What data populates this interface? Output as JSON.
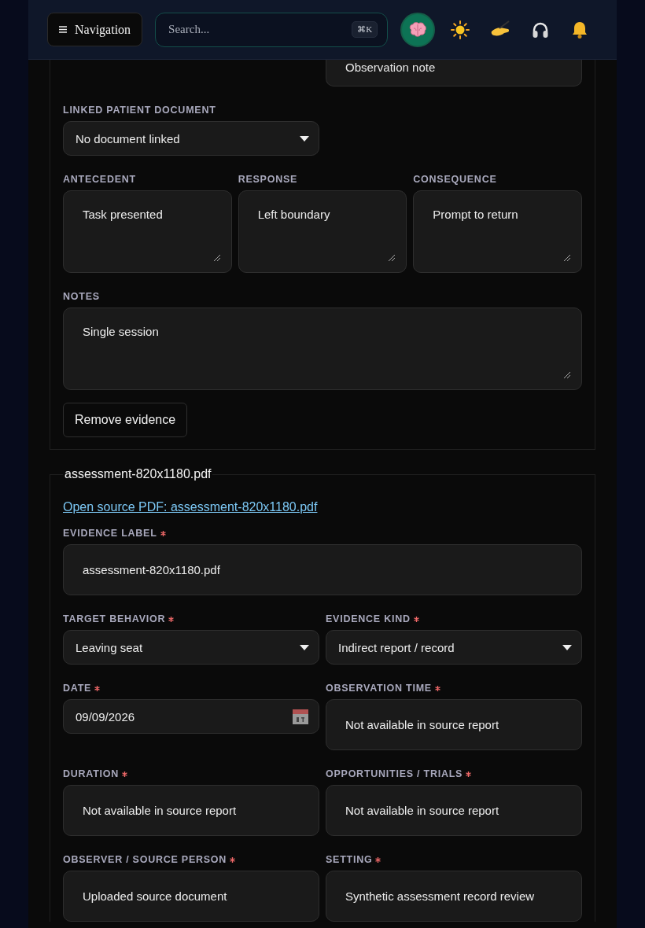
{
  "header": {
    "nav_button": {
      "label": "Navigation"
    },
    "search": {
      "placeholder": "Search...",
      "shortcut": "⌘K"
    }
  },
  "current_evidence": {
    "partial_field": {
      "value": "Observation note"
    },
    "rows": [
      {
        "fields": [
          {
            "label": "LINKED PATIENT DOCUMENT",
            "kind": "select",
            "value": "No document linked",
            "required": false
          }
        ]
      },
      {
        "fields": [
          {
            "label": "ANTECEDENT",
            "kind": "textarea",
            "value": "Task presented",
            "required": false
          },
          {
            "label": "RESPONSE",
            "kind": "textarea",
            "value": "Left boundary",
            "required": false
          },
          {
            "label": "CONSEQUENCE",
            "kind": "textarea",
            "value": "Prompt to return",
            "required": false
          }
        ]
      },
      {
        "fields": [
          {
            "label": "NOTES",
            "kind": "textarea",
            "value": "Single session",
            "required": false
          }
        ]
      }
    ],
    "remove_button": "Remove evidence"
  },
  "source_evidence": {
    "title": "assessment-820x1180.pdf",
    "link": "Open source PDF: assessment-820x1180.pdf",
    "rows": [
      {
        "fields": [
          {
            "label": "EVIDENCE LABEL",
            "kind": "input",
            "value": "assessment-820x1180.pdf",
            "required": true
          }
        ]
      },
      {
        "fields": [
          {
            "label": "TARGET BEHAVIOR",
            "kind": "select",
            "value": "Leaving seat",
            "required": true
          },
          {
            "label": "EVIDENCE KIND",
            "kind": "select",
            "value": "Indirect report / record",
            "required": true
          }
        ]
      },
      {
        "fields": [
          {
            "label": "DATE",
            "kind": "date",
            "value": "09/09/2026",
            "required": true
          },
          {
            "label": "OBSERVATION TIME",
            "kind": "input",
            "value": "Not available in source report",
            "required": true
          }
        ]
      },
      {
        "fields": [
          {
            "label": "DURATION",
            "kind": "input",
            "value": "Not available in source report",
            "required": true
          },
          {
            "label": "OPPORTUNITIES / TRIALS",
            "kind": "input",
            "value": "Not available in source report",
            "required": true
          }
        ]
      },
      {
        "fields": [
          {
            "label": "OBSERVER / SOURCE PERSON",
            "kind": "input",
            "value": "Uploaded source document",
            "required": true
          },
          {
            "label": "SETTING",
            "kind": "input",
            "value": "Synthetic assessment record review",
            "required": true
          }
        ]
      }
    ]
  }
}
